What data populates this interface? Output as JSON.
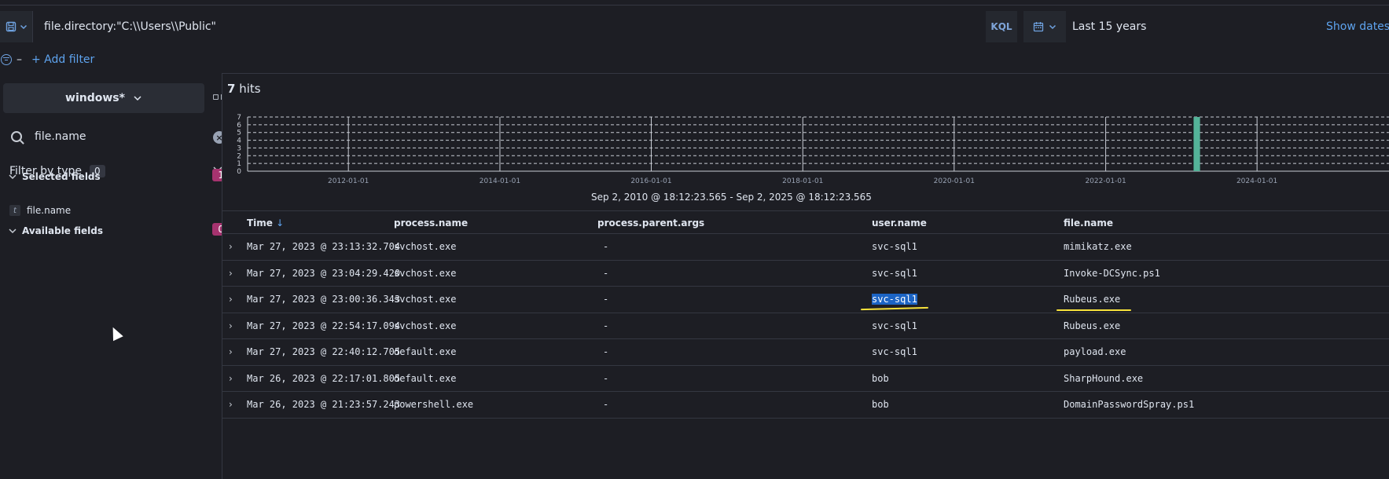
{
  "query_bar": {
    "query": "file.directory:\"C:\\\\Users\\\\Public\"",
    "language_label": "KQL",
    "time_range": "Last 15 years",
    "show_dates_label": "Show dates"
  },
  "filters": {
    "add_filter_label": "+ Add filter"
  },
  "sidebar": {
    "data_view": "windows*",
    "field_search_value": "file.name",
    "filter_by_type_label": "Filter by type",
    "filter_by_type_count": "0",
    "selected_fields_label": "Selected fields",
    "selected_fields_count": "1",
    "selected_fields": [
      "file.name"
    ],
    "available_fields_label": "Available fields",
    "available_fields_count": "0"
  },
  "hits": {
    "count": "7",
    "label": "hits"
  },
  "chart_data": {
    "type": "bar",
    "x_ticks": [
      "2012-01-01",
      "2014-01-01",
      "2016-01-01",
      "2018-01-01",
      "2020-01-01",
      "2022-01-01",
      "2024-01-01"
    ],
    "y_ticks": [
      0,
      1,
      2,
      3,
      4,
      5,
      6,
      7
    ],
    "ylim": [
      0,
      7
    ],
    "bars": [
      {
        "x": "2023-03",
        "value": 7
      }
    ],
    "range_label": "Sep 2, 2010 @ 18:12:23.565 - Sep 2, 2025 @ 18:12:23.565",
    "bar_color": "#54b399",
    "grid": true
  },
  "table": {
    "columns": [
      "Time",
      "process.name",
      "process.parent.args",
      "user.name",
      "file.name"
    ],
    "sort_indicator": "↓",
    "rows": [
      {
        "time": "Mar 27, 2023 @ 23:13:32.704",
        "process": "svchost.exe",
        "args": "-",
        "user": "svc-sql1",
        "file": "mimikatz.exe"
      },
      {
        "time": "Mar 27, 2023 @ 23:04:29.420",
        "process": "svchost.exe",
        "args": "-",
        "user": "svc-sql1",
        "file": "Invoke-DCSync.ps1"
      },
      {
        "time": "Mar 27, 2023 @ 23:00:36.343",
        "process": "svchost.exe",
        "args": "-",
        "user": "svc-sql1",
        "file": "Rubeus.exe"
      },
      {
        "time": "Mar 27, 2023 @ 22:54:17.094",
        "process": "svchost.exe",
        "args": "-",
        "user": "svc-sql1",
        "file": "Rubeus.exe"
      },
      {
        "time": "Mar 27, 2023 @ 22:40:12.705",
        "process": "default.exe",
        "args": "-",
        "user": "svc-sql1",
        "file": "payload.exe"
      },
      {
        "time": "Mar 26, 2023 @ 22:17:01.805",
        "process": "default.exe",
        "args": "-",
        "user": "bob",
        "file": "SharpHound.exe"
      },
      {
        "time": "Mar 26, 2023 @ 21:23:57.243",
        "process": "powershell.exe",
        "args": "-",
        "user": "bob",
        "file": "DomainPasswordSpray.ps1"
      }
    ]
  },
  "colors": {
    "background": "#1d1e24",
    "accent": "#5ea3ee",
    "badge": "#a6336f",
    "highlight": "#1c64c4",
    "annotation": "#f7e23b"
  }
}
